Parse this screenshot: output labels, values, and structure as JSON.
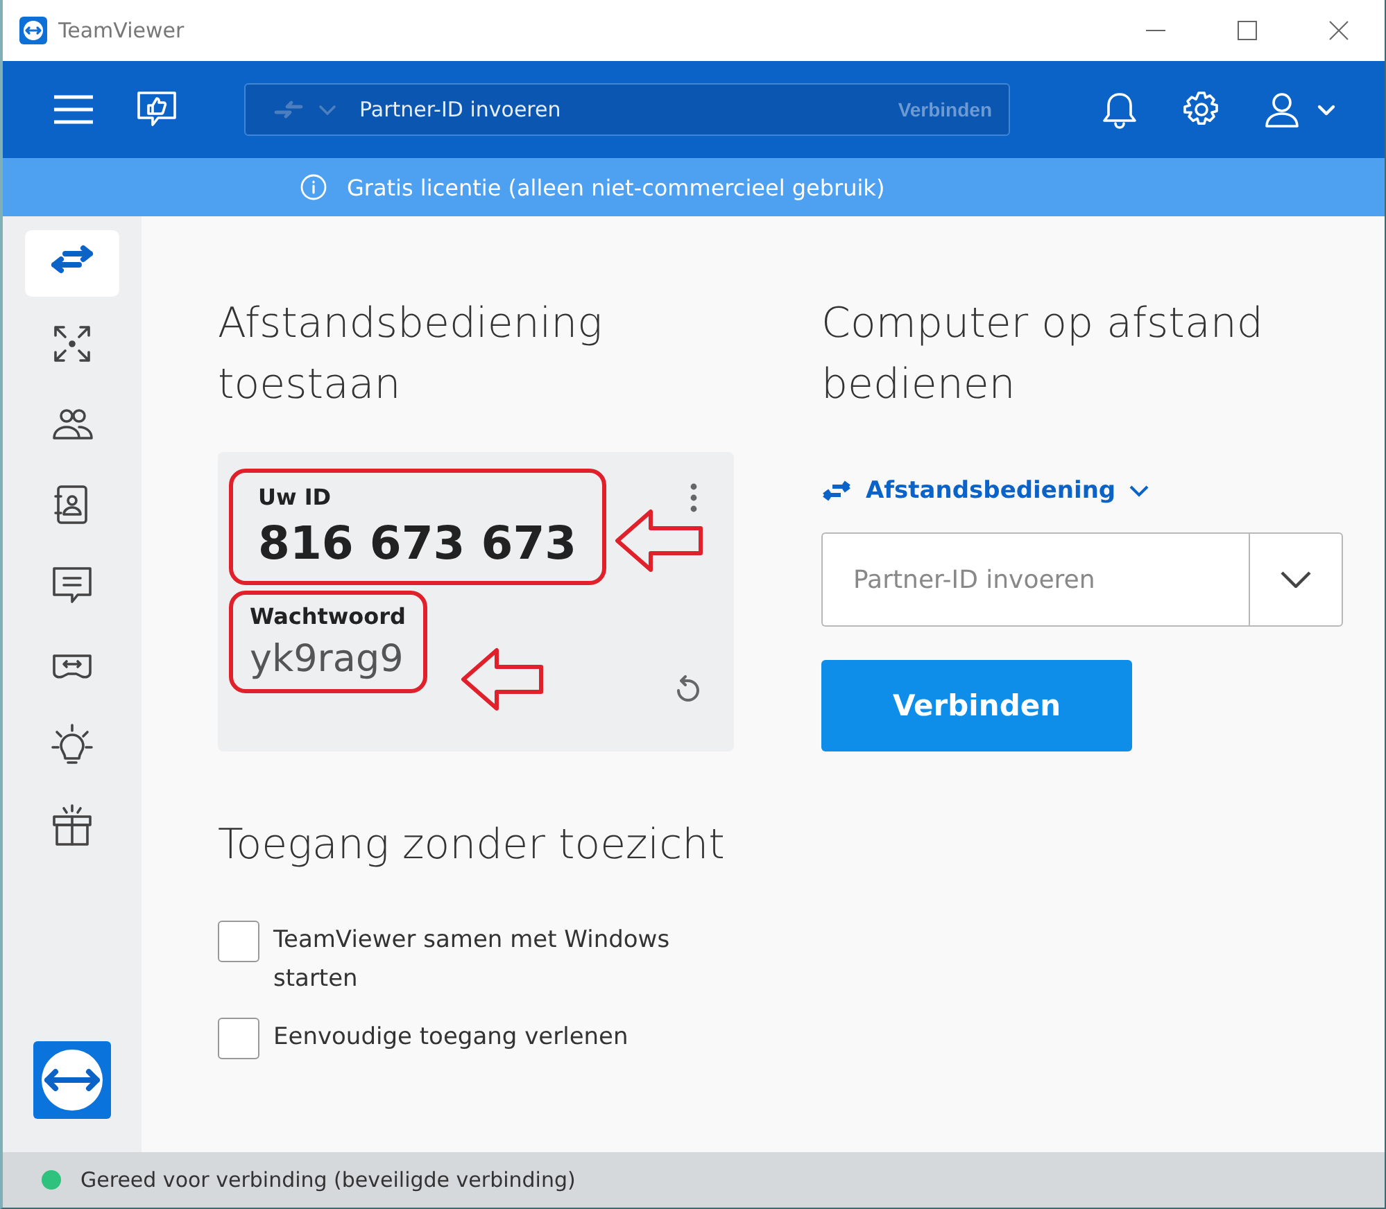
{
  "window": {
    "title": "TeamViewer"
  },
  "toolbar": {
    "search": {
      "placeholder": "Partner-ID invoeren"
    },
    "connect_label": "Verbinden"
  },
  "banner": {
    "text": "Gratis licentie (alleen niet-commercieel gebruik)"
  },
  "sidebar": {
    "items": [
      {
        "kind": "remote",
        "selected": true
      },
      {
        "kind": "meeting",
        "selected": false
      },
      {
        "kind": "contacts",
        "selected": false
      },
      {
        "kind": "addressbook",
        "selected": false
      },
      {
        "kind": "chat",
        "selected": false
      },
      {
        "kind": "ar",
        "selected": false
      },
      {
        "kind": "bulb",
        "selected": false
      },
      {
        "kind": "gift",
        "selected": false
      }
    ]
  },
  "allow": {
    "title": "Afstandsbediening toestaan",
    "id": {
      "label": "Uw ID",
      "value": "816 673 673",
      "highlighted": true
    },
    "password": {
      "label": "Wachtwoord",
      "value": "yk9rag9",
      "highlighted": true
    }
  },
  "unattended": {
    "title": "Toegang zonder toezicht",
    "options": [
      {
        "label": "TeamViewer samen met Windows starten",
        "checked": false
      },
      {
        "label": "Eenvoudige toegang verlenen",
        "checked": false
      }
    ]
  },
  "control": {
    "title": "Computer op afstand bedienen",
    "mode": "Afstandsbediening",
    "partner": {
      "placeholder": "Partner-ID invoeren"
    },
    "button": "Verbinden"
  },
  "status_bar": {
    "text": "Gereed voor verbinding (beveiligde verbinding)",
    "color": "#2ec27e"
  }
}
